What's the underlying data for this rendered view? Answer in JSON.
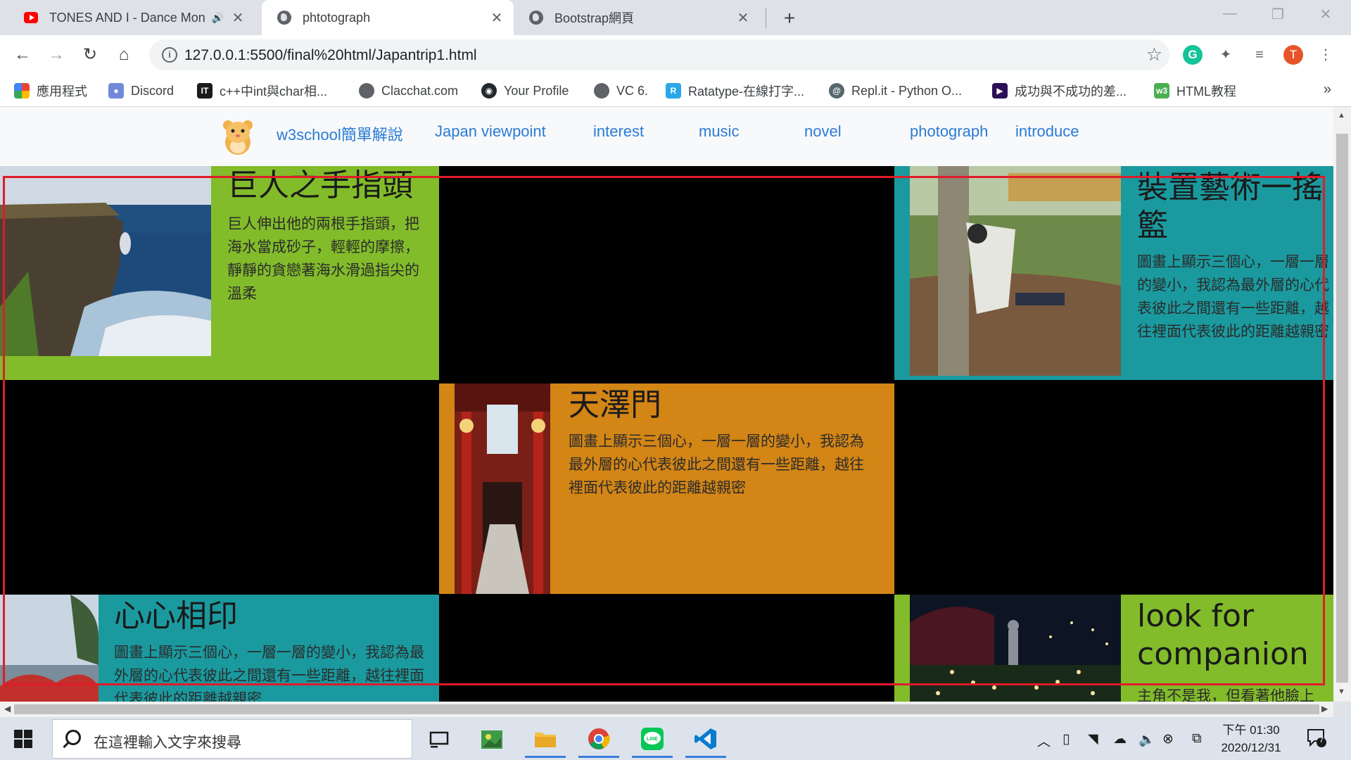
{
  "browser": {
    "tabs": [
      {
        "title": "TONES AND I - Dance Mon",
        "icon": "youtube-icon"
      },
      {
        "title": "phtotograph",
        "icon": "globe-icon"
      },
      {
        "title": "Bootstrap網頁",
        "icon": "globe-icon"
      }
    ],
    "url": "127.0.0.1:5500/final%20html/Japantrip1.html",
    "profile_initial": "T",
    "grammarly_initial": "G",
    "bookmarks": [
      {
        "label": "應用程式",
        "icon": "apps-grid-icon"
      },
      {
        "label": "Discord",
        "icon": "discord-icon"
      },
      {
        "label": "c++中int與char相...",
        "icon": "ithome-icon"
      },
      {
        "label": "Clacchat.com",
        "icon": "globe-icon"
      },
      {
        "label": "Your Profile",
        "icon": "github-icon"
      },
      {
        "label": "VC 6.",
        "icon": "globe-icon"
      },
      {
        "label": "Ratatype-在線打字...",
        "icon": "ratatype-icon"
      },
      {
        "label": "Repl.it - Python O...",
        "icon": "replit-icon"
      },
      {
        "label": "成功與不成功的差...",
        "icon": "video-icon"
      },
      {
        "label": "HTML教程",
        "icon": "w3-icon"
      }
    ]
  },
  "site": {
    "nav": [
      "w3school簡單解說",
      "Japan viewpoint",
      "interest",
      "music",
      "novel",
      "photograph",
      "introduce"
    ],
    "cards": {
      "giant": {
        "title": "巨人之手指頭",
        "text": "巨人伸出他的兩根手指頭，把海水當成砂子，輕輕的摩擦，靜靜的貪戀著海水滑過指尖的溫柔"
      },
      "hammock": {
        "title": "裝置藝術一搖籃",
        "text": "圖畫上顯示三個心，一層一層的變小，我認為最外層的心代表彼此之間還有一些距離，越往裡面代表彼此的距離越親密"
      },
      "gate": {
        "title": "天澤門",
        "text": "圖畫上顯示三個心，一層一層的變小，我認為最外層的心代表彼此之間還有一些距離，越往裡面代表彼此的距離越親密"
      },
      "hearts": {
        "title": "心心相印",
        "text": "圖畫上顯示三個心，一層一層的變小，我認為最外層的心代表彼此之間還有一些距離，越往裡面代表彼此的距離越親密"
      },
      "companion": {
        "title": "look for companion",
        "text": "主角不是我，但看著他臉上"
      }
    },
    "colors": {
      "green": "#82bc2a",
      "teal": "#1a9a9f",
      "orange": "#d38515",
      "highlight_box": "#e01b2a"
    }
  },
  "taskbar": {
    "search_placeholder": "在這裡輸入文字來搜尋",
    "time": "下午 01:30",
    "date": "2020/12/31",
    "notification_count": "7"
  }
}
